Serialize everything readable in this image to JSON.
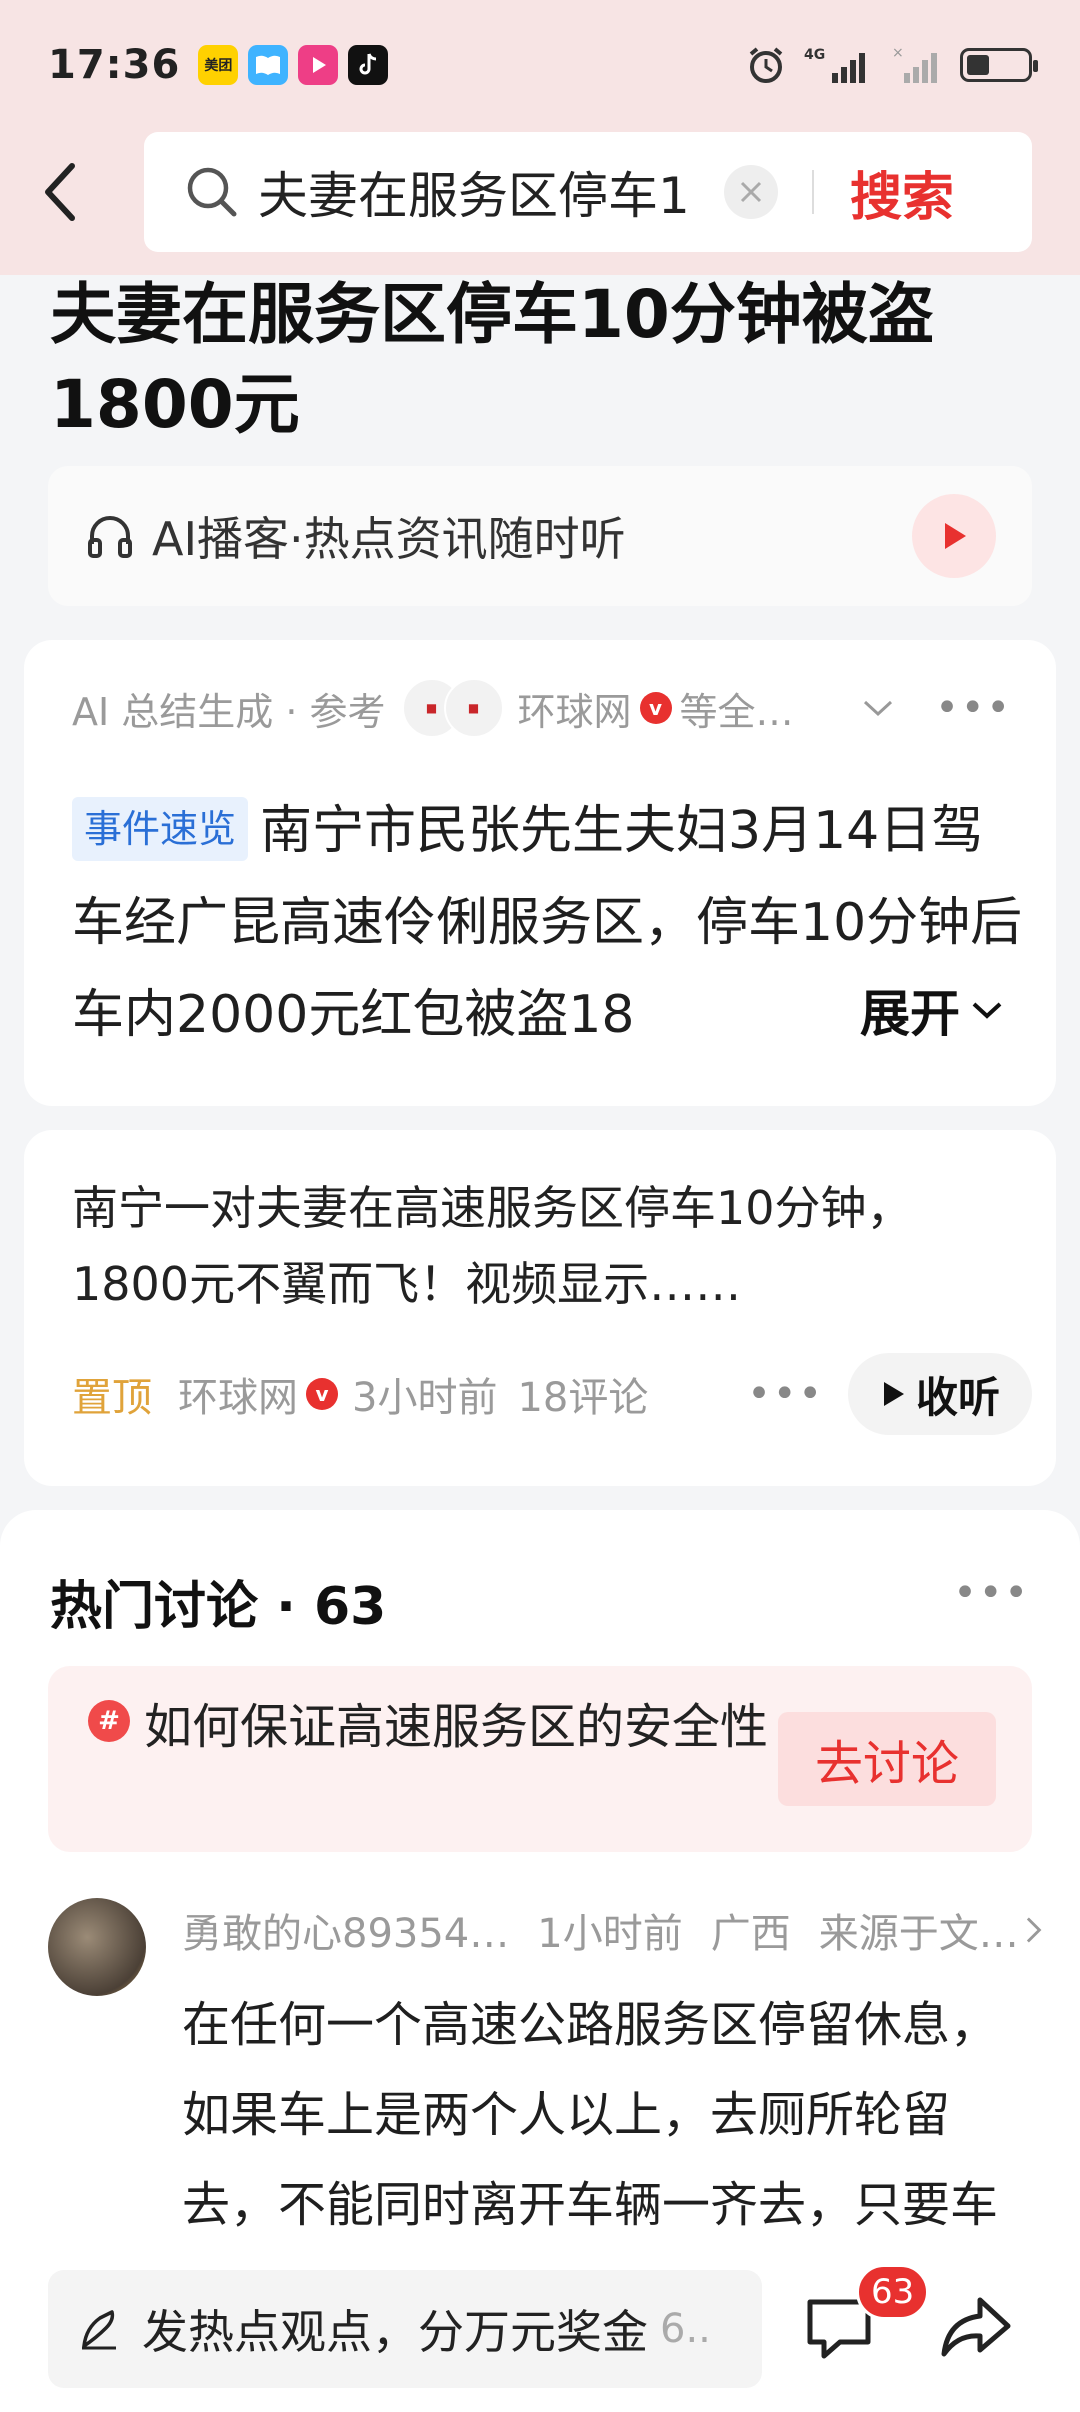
{
  "status_bar": {
    "time": "17:36",
    "network": "4G",
    "app_icons": [
      {
        "name": "meituan",
        "label": "美团",
        "color": "#ffd100"
      },
      {
        "name": "reader",
        "label": "",
        "color": "#3fb3ff"
      },
      {
        "name": "video",
        "label": "",
        "color": "#ee3e86"
      },
      {
        "name": "tiktok",
        "label": "",
        "color": "#111111"
      }
    ]
  },
  "header": {
    "search_query": "夫妻在服务区停车1",
    "search_button": "搜索"
  },
  "article": {
    "title": "夫妻在服务区停车10分钟被盗1800元"
  },
  "podcast": {
    "label": "AI播客·热点资讯随时听"
  },
  "ai_summary": {
    "meta_prefix": "AI 总结生成 · 参考",
    "source": "环球网",
    "meta_suffix": "等全…",
    "tag": "事件速览",
    "text": "南宁市民张先生夫妇3月14日驾车经广昆高速伶俐服务区，停车10分钟后车内2000元红包被盗18",
    "expand_label": "展开"
  },
  "news_item": {
    "title": "南宁一对夫妻在高速服务区停车10分钟，1800元不翼而飞！视频显示……",
    "pin_label": "置顶",
    "source": "环球网",
    "time": "3小时前",
    "comments": "18评论",
    "listen_label": "收听"
  },
  "discussion": {
    "heading": "热门讨论",
    "count": "· 63",
    "topic_text": "如何保证高速服务区的安全性",
    "topic_button": "去讨论",
    "comment": {
      "user": "勇敢的心89354…",
      "time": "1小时前",
      "location": "广西",
      "source": "来源于文…",
      "text": "在任何一个高速公路服务区停留休息，如果车上是两个人以上，去厕所轮留去，不能同时离开车辆一齐去，只要车上没留人看管车辆，失窃是百分之九十"
    }
  },
  "bottom_bar": {
    "input_placeholder": "发热点观点，分万元奖金",
    "input_suffix": "6..",
    "comment_badge": "63"
  }
}
